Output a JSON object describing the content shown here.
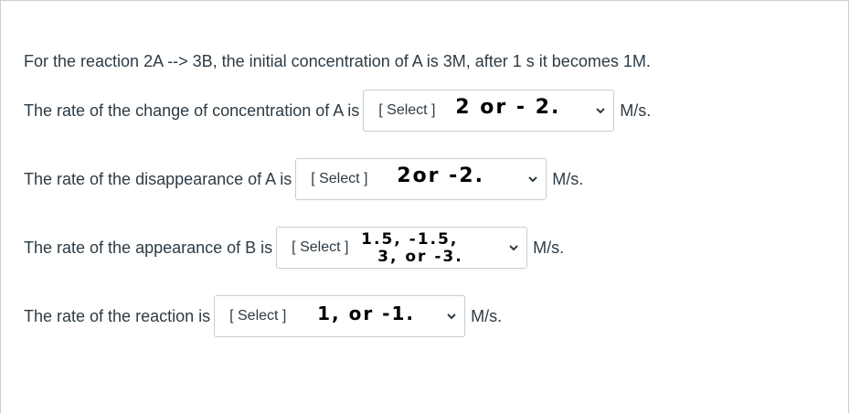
{
  "question": "For the reaction 2A --> 3B, the initial concentration of A is 3M, after 1 s it becomes 1M.",
  "rows": [
    {
      "label": "The rate of the change of concentration of A is",
      "select_label": "[ Select ]",
      "handwriting": [
        "2 or - 2."
      ],
      "unit": "M/s."
    },
    {
      "label": "The rate of the disappearance  of A is",
      "select_label": "[ Select ]",
      "handwriting": [
        "2or -2."
      ],
      "unit": "M/s."
    },
    {
      "label": "The rate of the appearance  of B is",
      "select_label": "[ Select ]",
      "handwriting": [
        "1.5, -1.5,",
        "3, or -3."
      ],
      "unit": "M/s."
    },
    {
      "label": "The rate of the reaction is",
      "select_label": "[ Select ]",
      "handwriting": [
        "1, or -1."
      ],
      "unit": "M/s."
    }
  ],
  "icons": {
    "dropdown": "chevron-down-icon"
  }
}
